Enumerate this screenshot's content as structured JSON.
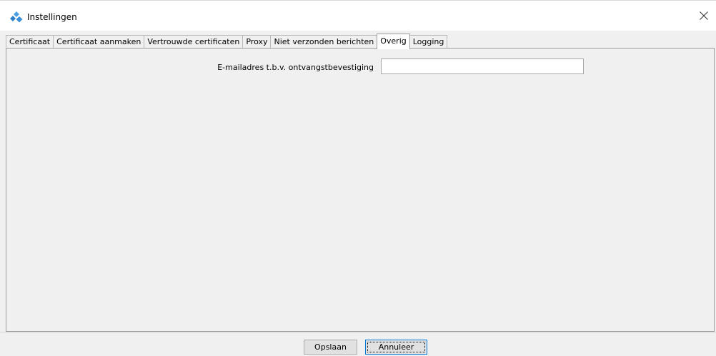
{
  "window": {
    "title": "Instellingen",
    "icon": "app-diamond-cluster-icon",
    "close_icon": "close-icon"
  },
  "tabs": [
    {
      "label": "Certificaat",
      "active": false
    },
    {
      "label": "Certificaat aanmaken",
      "active": false
    },
    {
      "label": "Vertrouwde certificaten",
      "active": false
    },
    {
      "label": "Proxy",
      "active": false
    },
    {
      "label": "Niet verzonden berichten",
      "active": false
    },
    {
      "label": "Overig",
      "active": true
    },
    {
      "label": "Logging",
      "active": false
    }
  ],
  "overig": {
    "email_label": "E-mailadres t.b.v. ontvangstbevestiging",
    "email_value": "",
    "email_placeholder": ""
  },
  "buttons": {
    "save_label": "Opslaan",
    "cancel_label": "Annuleer"
  },
  "colors": {
    "window_bg": "#f0f0f0",
    "titlebar_bg": "#ffffff",
    "icon_blue": "#3a8fd6",
    "focus_blue": "#0078d7"
  }
}
